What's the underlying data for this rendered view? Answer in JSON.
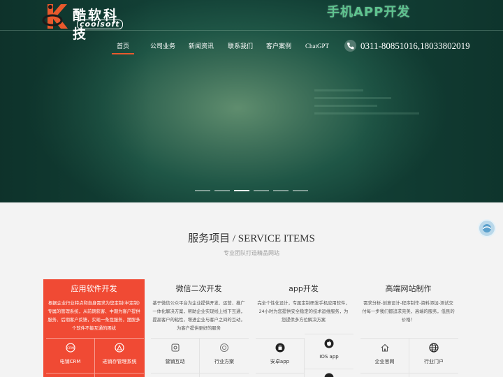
{
  "brand": {
    "name_cn": "酷软科技",
    "name_en": "coolsoft",
    "slogan": "手机APP开发"
  },
  "nav": {
    "items": [
      {
        "label": "首页",
        "active": true
      },
      {
        "label": "公司业务",
        "active": false
      },
      {
        "label": "新闻资讯",
        "active": false
      },
      {
        "label": "联系我们",
        "active": false
      },
      {
        "label": "客户案例",
        "active": false
      },
      {
        "label": "ChatGPT",
        "active": false
      }
    ]
  },
  "contact": {
    "phone": "0311-80851016,18033802019",
    "icon": "phone-icon"
  },
  "slider": {
    "dot_count": 6,
    "active_index": 2
  },
  "services": {
    "title": "服务项目 / SERVICE ITEMS",
    "subtitle": "专业团队打造精品网站",
    "cards": [
      {
        "title": "应用软件开发",
        "desc": "根据企业行业特点和自身需求为您定制(半定制)专属的管理系统，从前期获客、中期为客户提供服务、后期客户反馈，实现一条龙服务，摆脱多个软件不能互通的困扰",
        "items": [
          {
            "label": "电销CRM",
            "icon": "crm-icon"
          },
          {
            "label": "进销存管理系统",
            "icon": "inventory-icon"
          }
        ]
      },
      {
        "title": "微信二次开发",
        "desc": "基于微信公众平台为企业提供开发、运营、推广一体化解决方案，帮助企业实现线上线下互通，提高客户的粘性，增进企业与客户之间的互动，为客户提供更好的服务",
        "items": [
          {
            "label": "营销互动",
            "icon": "marketing-icon"
          },
          {
            "label": "行业方案",
            "icon": "solution-icon"
          }
        ]
      },
      {
        "title": "app开发",
        "desc": "完全个性化设计，专属定制研发手机应用软件，24小时为您提供安全稳定的技术运维服务，为您提供多方位解决方案",
        "items": [
          {
            "label": "安卓app",
            "icon": "android-icon"
          },
          {
            "label": "IOS app",
            "icon": "apple-icon"
          }
        ]
      },
      {
        "title": "高端网站制作",
        "desc": "需求分析-创意设计-程序制作-资料添加-测试交付每一步我们都追求完美，高端的服务，低民的价格！",
        "items": [
          {
            "label": "企业官网",
            "icon": "home-icon"
          },
          {
            "label": "行业门户",
            "icon": "globe-icon"
          }
        ]
      }
    ]
  },
  "colors": {
    "accent": "#f04a34",
    "nav_active": "#e9592c",
    "slogan": "#5ec48f",
    "hero_dark": "#123f35"
  }
}
